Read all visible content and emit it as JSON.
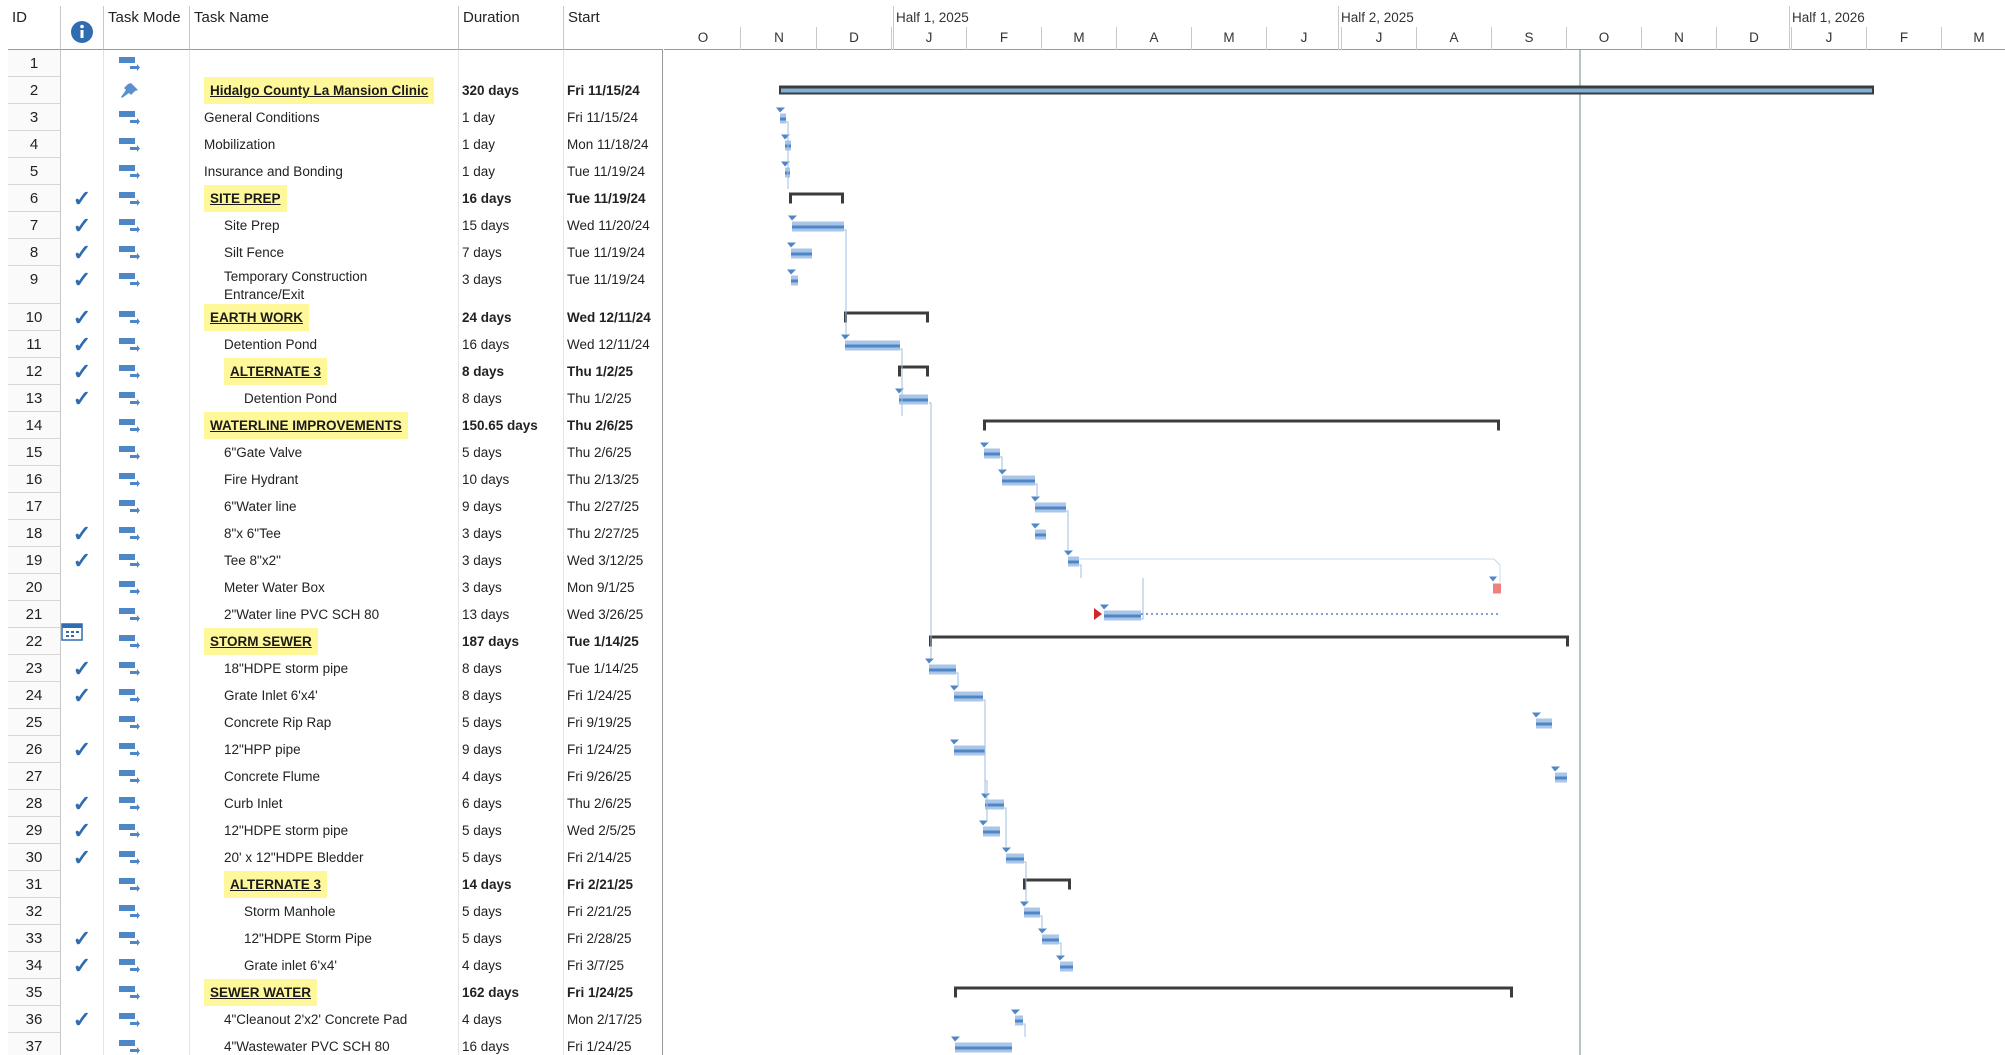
{
  "columns": {
    "id": "ID",
    "indicators": "",
    "mode": "Task Mode",
    "name": "Task Name",
    "duration": "Duration",
    "start": "Start"
  },
  "timescale": {
    "halves": [
      "Half 1, 2025",
      "Half 2, 2025",
      "Half 1, 2026"
    ],
    "months": [
      "O",
      "N",
      "D",
      "J",
      "F",
      "M",
      "A",
      "M",
      "J",
      "J",
      "A",
      "S",
      "O",
      "N",
      "D",
      "J",
      "F",
      "M"
    ]
  },
  "colors": {
    "bar": "#4f86c6",
    "bar_light": "#a9c6e8",
    "summary": "#3c3c3c",
    "highlight": "#fff89a",
    "check": "#2f6db0",
    "milestone_red": "#e05050"
  },
  "tasks": [
    {
      "id": "1",
      "name": "",
      "duration": "",
      "start": "",
      "indicator": "",
      "mode": "auto",
      "level": 0,
      "summary": false
    },
    {
      "id": "2",
      "name": "Hidalgo County La Mansion Clinic",
      "duration": "320 days",
      "start": "Fri 11/15/24",
      "indicator": "",
      "mode": "pin",
      "level": 0,
      "summary": true,
      "project": true
    },
    {
      "id": "3",
      "name": "General Conditions",
      "duration": "1 day",
      "start": "Fri 11/15/24",
      "indicator": "",
      "mode": "auto",
      "level": 1,
      "summary": false
    },
    {
      "id": "4",
      "name": "Mobilization",
      "duration": "1 day",
      "start": "Mon 11/18/24",
      "indicator": "",
      "mode": "auto",
      "level": 1,
      "summary": false
    },
    {
      "id": "5",
      "name": "Insurance and Bonding",
      "duration": "1 day",
      "start": "Tue 11/19/24",
      "indicator": "",
      "mode": "auto",
      "level": 1,
      "summary": false
    },
    {
      "id": "6",
      "name": "SITE PREP",
      "duration": "16 days",
      "start": "Tue 11/19/24",
      "indicator": "check",
      "mode": "auto",
      "level": 1,
      "summary": true
    },
    {
      "id": "7",
      "name": "Site Prep",
      "duration": "15 days",
      "start": "Wed 11/20/24",
      "indicator": "check",
      "mode": "auto",
      "level": 2,
      "summary": false
    },
    {
      "id": "8",
      "name": "Silt Fence",
      "duration": "7 days",
      "start": "Tue 11/19/24",
      "indicator": "check",
      "mode": "auto",
      "level": 2,
      "summary": false
    },
    {
      "id": "9",
      "name": "Temporary Construction Entrance/Exit",
      "duration": "3 days",
      "start": "Tue 11/19/24",
      "indicator": "check",
      "mode": "auto",
      "level": 2,
      "summary": false
    },
    {
      "id": "10",
      "name": "EARTH WORK",
      "duration": "24 days",
      "start": "Wed 12/11/24",
      "indicator": "check",
      "mode": "auto",
      "level": 1,
      "summary": true
    },
    {
      "id": "11",
      "name": "Detention Pond",
      "duration": "16 days",
      "start": "Wed 12/11/24",
      "indicator": "check",
      "mode": "auto",
      "level": 2,
      "summary": false
    },
    {
      "id": "12",
      "name": "ALTERNATE 3",
      "duration": "8 days",
      "start": "Thu 1/2/25",
      "indicator": "check",
      "mode": "auto",
      "level": 2,
      "summary": true
    },
    {
      "id": "13",
      "name": "Detention Pond",
      "duration": "8 days",
      "start": "Thu 1/2/25",
      "indicator": "check",
      "mode": "auto",
      "level": 3,
      "summary": false
    },
    {
      "id": "14",
      "name": "WATERLINE IMPROVEMENTS",
      "duration": "150.65 days",
      "start": "Thu 2/6/25",
      "indicator": "",
      "mode": "auto",
      "level": 1,
      "summary": true
    },
    {
      "id": "15",
      "name": "6\"Gate Valve",
      "duration": "5 days",
      "start": "Thu 2/6/25",
      "indicator": "",
      "mode": "auto",
      "level": 2,
      "summary": false
    },
    {
      "id": "16",
      "name": "Fire Hydrant",
      "duration": "10 days",
      "start": "Thu 2/13/25",
      "indicator": "",
      "mode": "auto",
      "level": 2,
      "summary": false
    },
    {
      "id": "17",
      "name": "6\"Water line",
      "duration": "9 days",
      "start": "Thu 2/27/25",
      "indicator": "",
      "mode": "auto",
      "level": 2,
      "summary": false
    },
    {
      "id": "18",
      "name": "8\"x 6\"Tee",
      "duration": "3 days",
      "start": "Thu 2/27/25",
      "indicator": "check",
      "mode": "auto",
      "level": 2,
      "summary": false
    },
    {
      "id": "19",
      "name": "Tee 8\"x2\"",
      "duration": "3 days",
      "start": "Wed 3/12/25",
      "indicator": "check",
      "mode": "auto",
      "level": 2,
      "summary": false
    },
    {
      "id": "20",
      "name": "Meter Water Box",
      "duration": "3 days",
      "start": "Mon 9/1/25",
      "indicator": "calendar",
      "mode": "auto",
      "level": 2,
      "summary": false
    },
    {
      "id": "21",
      "name": "2\"Water line PVC SCH 80",
      "duration": "13 days",
      "start": "Wed 3/26/25",
      "indicator": "",
      "mode": "auto",
      "level": 2,
      "summary": false
    },
    {
      "id": "22",
      "name": "STORM SEWER",
      "duration": "187 days",
      "start": "Tue 1/14/25",
      "indicator": "",
      "mode": "auto",
      "level": 1,
      "summary": true
    },
    {
      "id": "23",
      "name": "18\"HDPE storm pipe",
      "duration": "8 days",
      "start": "Tue 1/14/25",
      "indicator": "check",
      "mode": "auto",
      "level": 2,
      "summary": false
    },
    {
      "id": "24",
      "name": "Grate Inlet 6'x4'",
      "duration": "8 days",
      "start": "Fri 1/24/25",
      "indicator": "check",
      "mode": "auto",
      "level": 2,
      "summary": false
    },
    {
      "id": "25",
      "name": "Concrete Rip Rap",
      "duration": "5 days",
      "start": "Fri 9/19/25",
      "indicator": "",
      "mode": "auto",
      "level": 2,
      "summary": false
    },
    {
      "id": "26",
      "name": "12\"HPP pipe",
      "duration": "9 days",
      "start": "Fri 1/24/25",
      "indicator": "check",
      "mode": "auto",
      "level": 2,
      "summary": false
    },
    {
      "id": "27",
      "name": "Concrete Flume",
      "duration": "4 days",
      "start": "Fri 9/26/25",
      "indicator": "",
      "mode": "auto",
      "level": 2,
      "summary": false
    },
    {
      "id": "28",
      "name": "Curb Inlet",
      "duration": "6 days",
      "start": "Thu 2/6/25",
      "indicator": "check",
      "mode": "auto",
      "level": 2,
      "summary": false
    },
    {
      "id": "29",
      "name": "12\"HDPE storm pipe",
      "duration": "5 days",
      "start": "Wed 2/5/25",
      "indicator": "check",
      "mode": "auto",
      "level": 2,
      "summary": false
    },
    {
      "id": "30",
      "name": "20' x 12\"HDPE Bledder",
      "duration": "5 days",
      "start": "Fri 2/14/25",
      "indicator": "check",
      "mode": "auto",
      "level": 2,
      "summary": false
    },
    {
      "id": "31",
      "name": "ALTERNATE 3",
      "duration": "14 days",
      "start": "Fri 2/21/25",
      "indicator": "",
      "mode": "auto",
      "level": 2,
      "summary": true
    },
    {
      "id": "32",
      "name": "Storm Manhole",
      "duration": "5 days",
      "start": "Fri 2/21/25",
      "indicator": "",
      "mode": "auto",
      "level": 3,
      "summary": false
    },
    {
      "id": "33",
      "name": "12\"HDPE Storm Pipe",
      "duration": "5 days",
      "start": "Fri 2/28/25",
      "indicator": "check",
      "mode": "auto",
      "level": 3,
      "summary": false
    },
    {
      "id": "34",
      "name": "Grate inlet 6'x4'",
      "duration": "4 days",
      "start": "Fri 3/7/25",
      "indicator": "check",
      "mode": "auto",
      "level": 3,
      "summary": false
    },
    {
      "id": "35",
      "name": "SEWER WATER",
      "duration": "162 days",
      "start": "Fri 1/24/25",
      "indicator": "",
      "mode": "auto",
      "level": 1,
      "summary": true
    },
    {
      "id": "36",
      "name": "4\"Cleanout 2'x2' Concrete Pad",
      "duration": "4 days",
      "start": "Mon 2/17/25",
      "indicator": "check",
      "mode": "auto",
      "level": 2,
      "summary": false
    },
    {
      "id": "37",
      "name": "4\"Wastewater PVC SCH 80",
      "duration": "16 days",
      "start": "Fri 1/24/25",
      "indicator": "",
      "mode": "auto",
      "level": 2,
      "summary": false
    }
  ]
}
